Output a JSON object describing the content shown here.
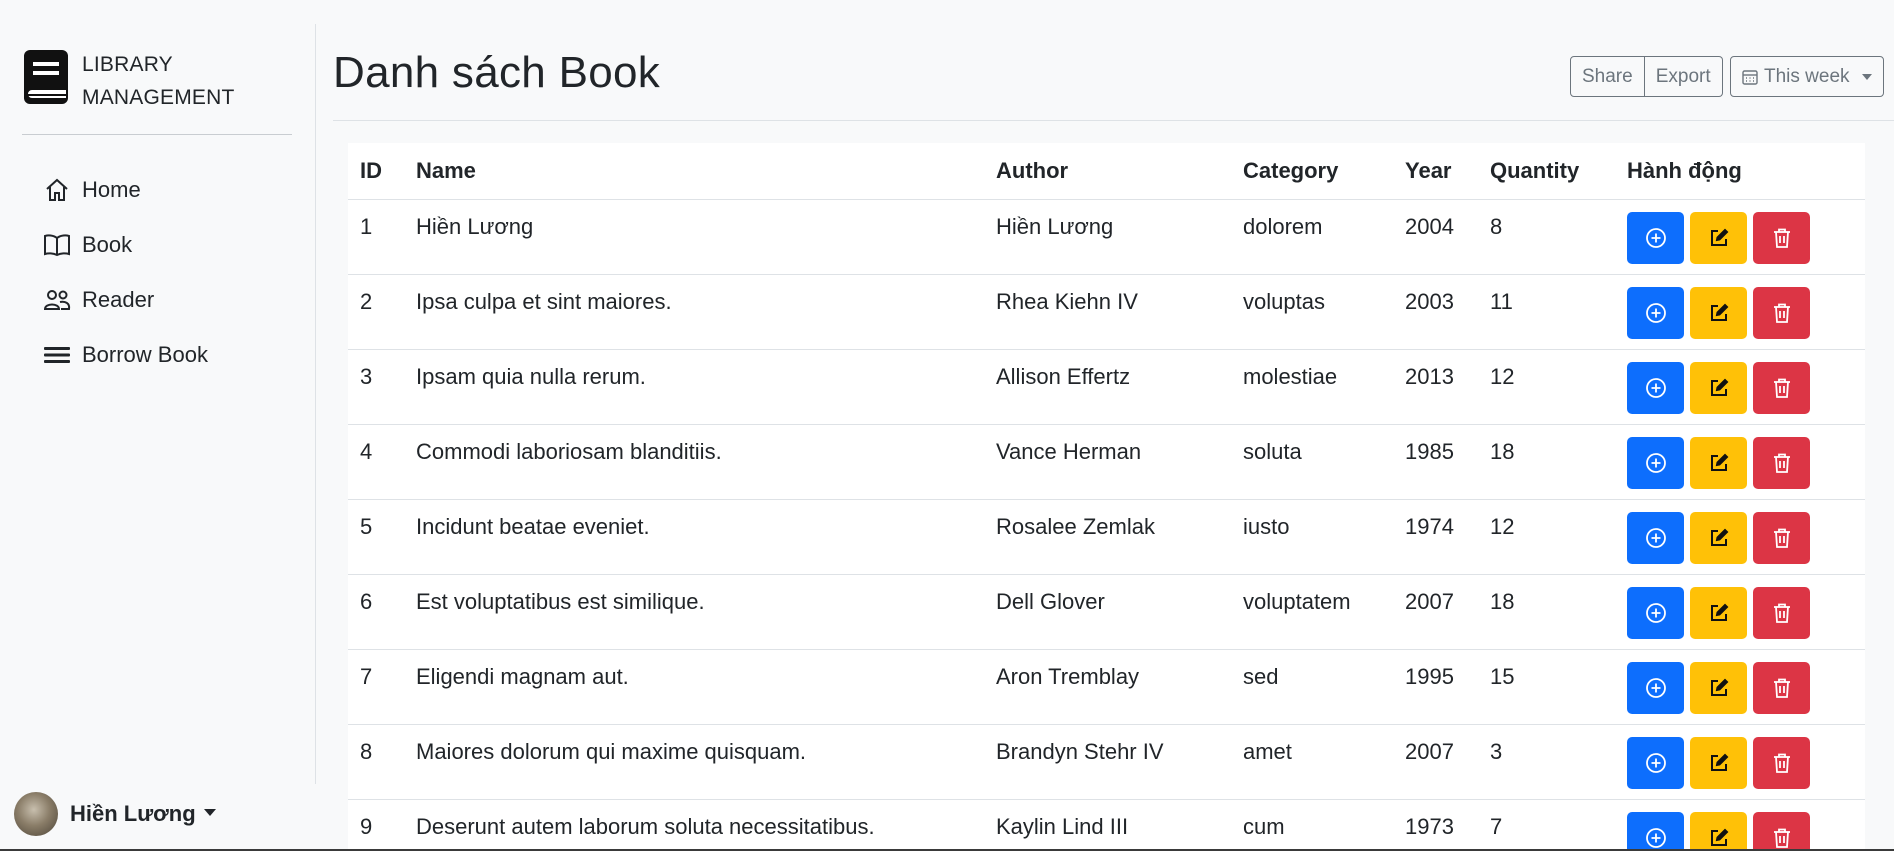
{
  "brand": {
    "line1": "LIBRARY",
    "line2": "MANAGEMENT",
    "icon": "book-icon"
  },
  "nav": [
    {
      "label": "Home",
      "icon": "house-icon"
    },
    {
      "label": "Book",
      "icon": "open-book-icon"
    },
    {
      "label": "Reader",
      "icon": "people-icon"
    },
    {
      "label": "Borrow Book",
      "icon": "list-icon"
    }
  ],
  "user": {
    "name": "Hiền Lương"
  },
  "page": {
    "title": "Danh sách Book"
  },
  "toolbar": {
    "share_label": "Share",
    "export_label": "Export",
    "period_label": "This week"
  },
  "table": {
    "headers": [
      "ID",
      "Name",
      "Author",
      "Category",
      "Year",
      "Quantity",
      "Hành động"
    ],
    "rows": [
      [
        "1",
        "Hiền Lương",
        "Hiền Lương",
        "dolorem",
        "2004",
        "8"
      ],
      [
        "2",
        "Ipsa culpa et sint maiores.",
        "Rhea Kiehn IV",
        "voluptas",
        "2003",
        "11"
      ],
      [
        "3",
        "Ipsam quia nulla rerum.",
        "Allison Effertz",
        "molestiae",
        "2013",
        "12"
      ],
      [
        "4",
        "Commodi laboriosam blanditiis.",
        "Vance Herman",
        "soluta",
        "1985",
        "18"
      ],
      [
        "5",
        "Incidunt beatae eveniet.",
        "Rosalee Zemlak",
        "iusto",
        "1974",
        "12"
      ],
      [
        "6",
        "Est voluptatibus est similique.",
        "Dell Glover",
        "voluptatem",
        "2007",
        "18"
      ],
      [
        "7",
        "Eligendi magnam aut.",
        "Aron Tremblay",
        "sed",
        "1995",
        "15"
      ],
      [
        "8",
        "Maiores dolorum qui maxime quisquam.",
        "Brandyn Stehr IV",
        "amet",
        "2007",
        "3"
      ],
      [
        "9",
        "Deserunt autem laborum soluta necessitatibus.",
        "Kaylin Lind III",
        "cum",
        "1973",
        "7"
      ]
    ]
  },
  "colors": {
    "primary": "#0d6efd",
    "warning": "#ffc107",
    "danger": "#dc3545"
  }
}
